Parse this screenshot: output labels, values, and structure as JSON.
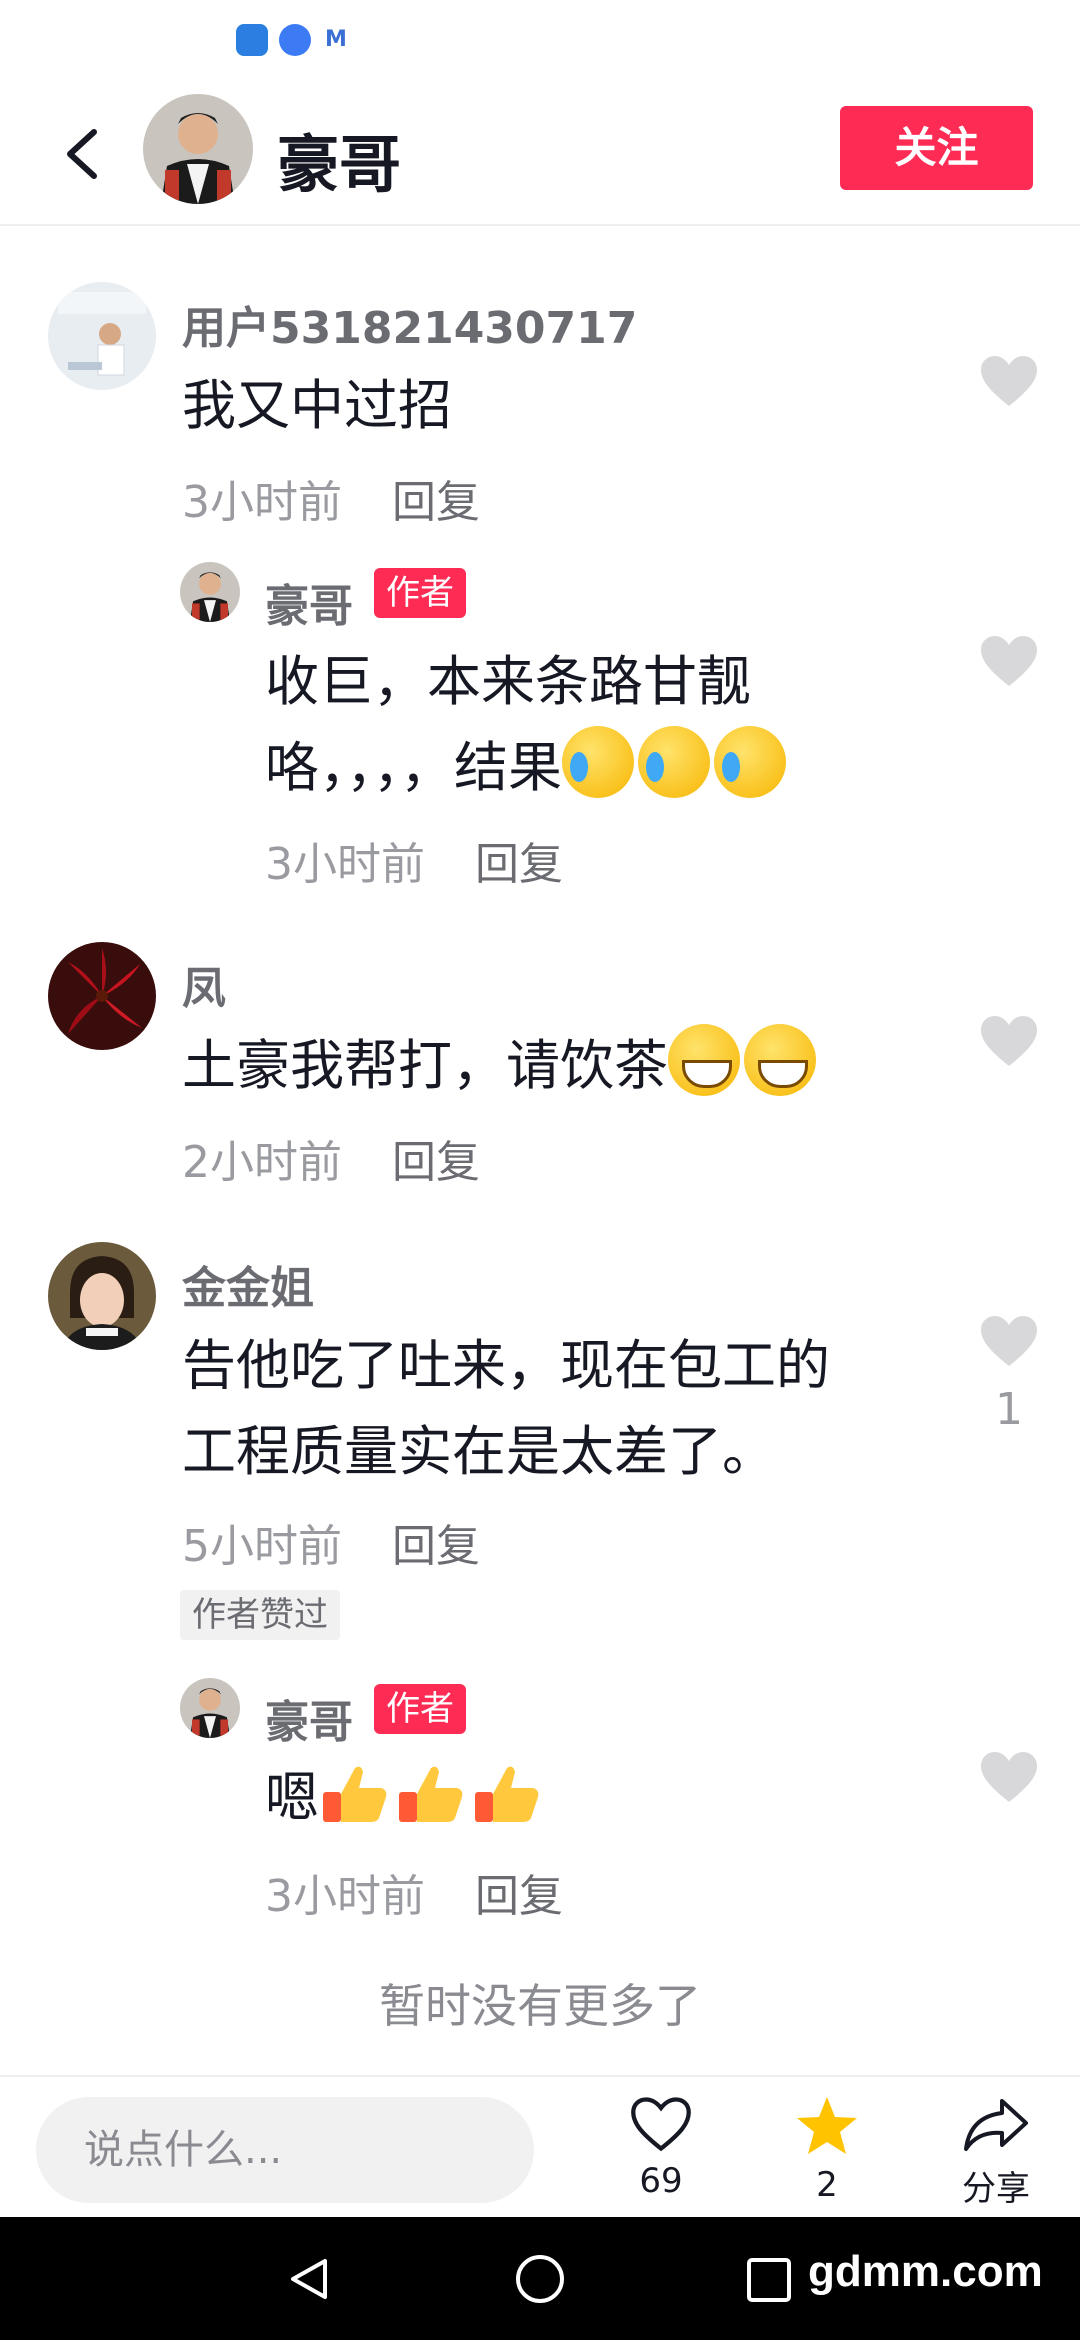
{
  "header": {
    "name": "豪哥",
    "follow_label": "关注"
  },
  "comments": [
    {
      "name": "用户531821430717",
      "text": "我又中过招",
      "time": "3小时前",
      "reply": "回复"
    },
    {
      "name": "豪哥",
      "tag": "作者",
      "text_line1": "收巨，本来条路甘靓",
      "text_line2": "咯，，，，结果",
      "time": "3小时前",
      "reply": "回复"
    },
    {
      "name": "凤",
      "text": "土豪我帮打，请饮茶",
      "time": "2小时前",
      "reply": "回复"
    },
    {
      "name": "金金姐",
      "text_line1": "告他吃了吐来，现在包工的",
      "text_line2": "工程质量实在是太差了。",
      "time": "5小时前",
      "reply": "回复",
      "liked_tag": "作者赞过",
      "likes": "1"
    },
    {
      "name": "豪哥",
      "tag": "作者",
      "text": "嗯",
      "time": "3小时前",
      "reply": "回复"
    }
  ],
  "no_more": "暂时没有更多了",
  "bottom": {
    "placeholder": "说点什么...",
    "like_count": "69",
    "star_count": "2",
    "share_label": "分享"
  },
  "watermark": "gdmm.com",
  "icons": [
    "back-icon",
    "heart-icon",
    "star-icon",
    "share-icon",
    "nav-back-icon",
    "nav-home-icon",
    "nav-recents-icon"
  ],
  "colors": {
    "accent": "#fe2c55",
    "star": "#ffc300"
  }
}
